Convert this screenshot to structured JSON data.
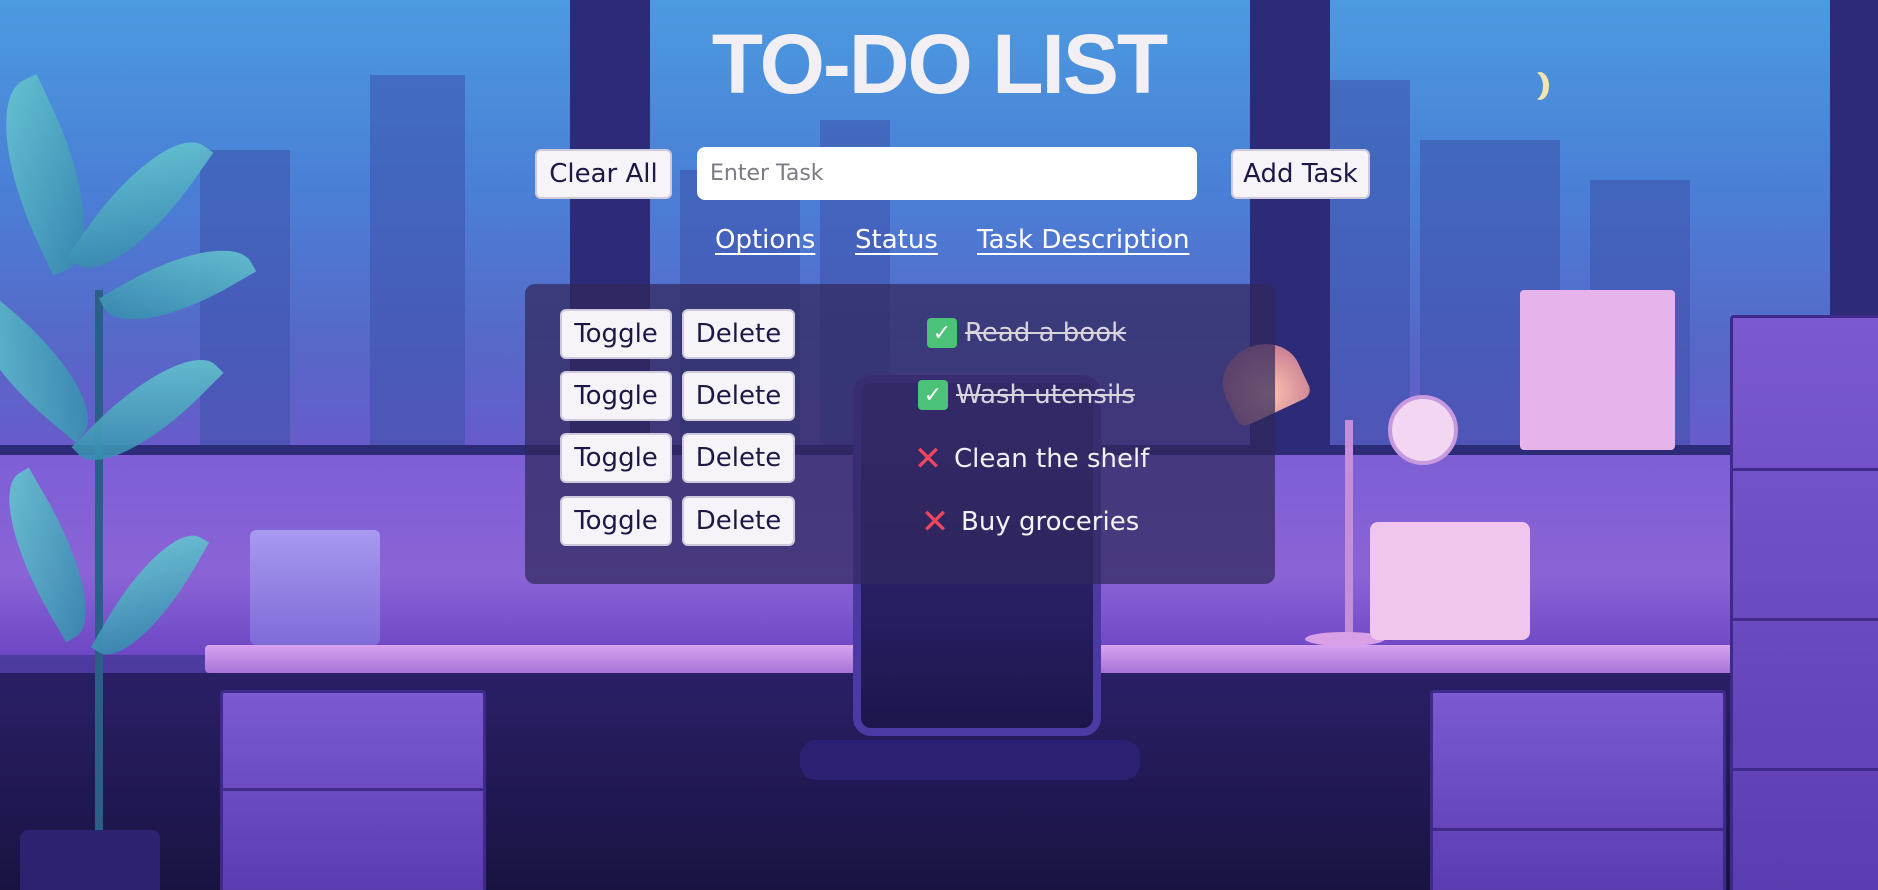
{
  "app": {
    "title": "TO-DO LIST"
  },
  "toolbar": {
    "clear_label": "Clear All",
    "input_placeholder": "Enter Task",
    "input_value": "",
    "add_label": "Add Task"
  },
  "columns": {
    "options": "Options",
    "status": "Status",
    "description": "Task Description"
  },
  "tasks": [
    {
      "toggle_label": "Toggle",
      "delete_label": "Delete",
      "status": "done",
      "status_icon": "checkbox-checked-icon",
      "text": "Read a book"
    },
    {
      "toggle_label": "Toggle",
      "delete_label": "Delete",
      "status": "done",
      "status_icon": "checkbox-checked-icon",
      "text": "Wash utensils"
    },
    {
      "toggle_label": "Toggle",
      "delete_label": "Delete",
      "status": "pending",
      "status_icon": "cross-mark-icon",
      "text": "Clean the shelf"
    },
    {
      "toggle_label": "Toggle",
      "delete_label": "Delete",
      "status": "pending",
      "status_icon": "cross-mark-icon",
      "text": "Buy groceries"
    }
  ],
  "colors": {
    "title": "#f1eef4",
    "done_badge": "#4bc277",
    "pending_mark": "#f0455f",
    "panel_bg": "#30285c"
  }
}
